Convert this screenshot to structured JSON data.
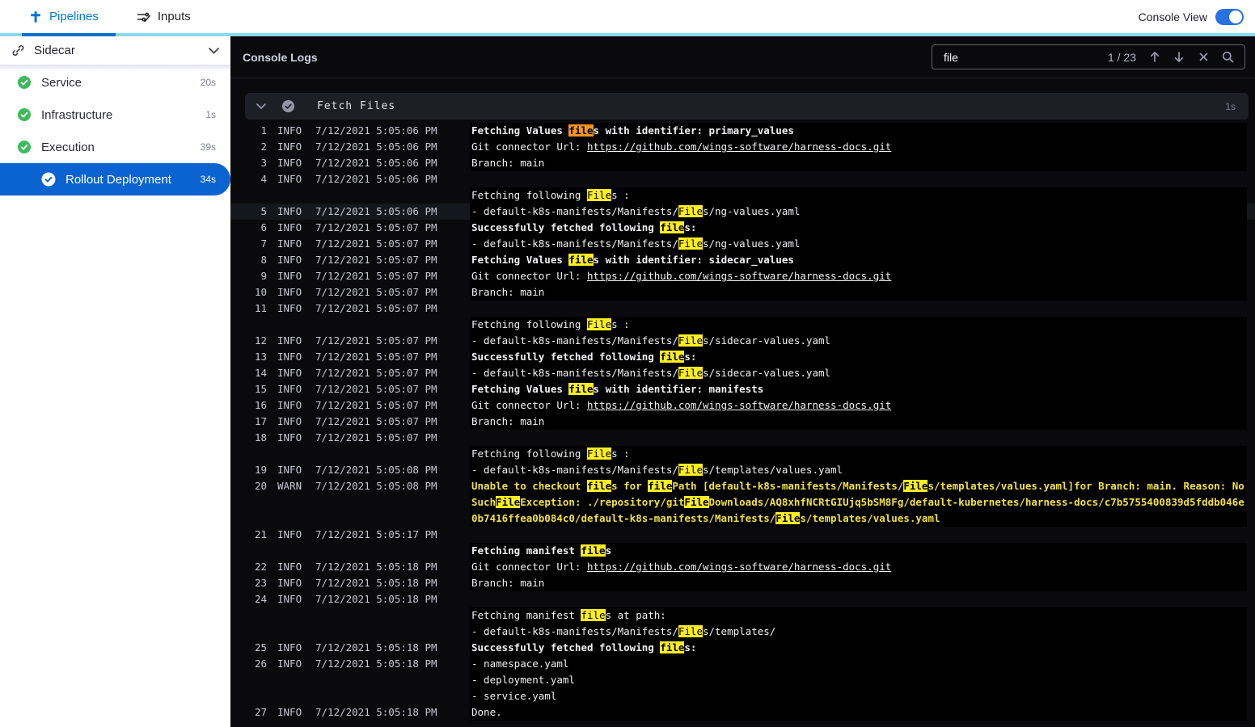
{
  "topbar": {
    "tabs": [
      {
        "label": "Pipelines",
        "active": true
      },
      {
        "label": "Inputs",
        "active": false
      }
    ],
    "console_view_label": "Console View",
    "console_view_on": true
  },
  "sidebar": {
    "pipeline_name": "Sidecar",
    "items": [
      {
        "label": "Service",
        "duration": "20s",
        "status": "success",
        "selected": false
      },
      {
        "label": "Infrastructure",
        "duration": "1s",
        "status": "success",
        "selected": false
      },
      {
        "label": "Execution",
        "duration": "39s",
        "status": "success",
        "selected": false
      },
      {
        "label": "Rollout Deployment",
        "duration": "34s",
        "status": "success",
        "selected": true
      }
    ]
  },
  "console": {
    "title": "Console Logs",
    "search": {
      "value": "file",
      "count": "1 / 23"
    },
    "section": {
      "title": "Fetch Files",
      "duration": "1s"
    },
    "lines": [
      {
        "num": "1",
        "level": "INFO",
        "time": "7/12/2021 5:05:06 PM",
        "text": "Fetching Values files with identifier: primary_values",
        "bold": true
      },
      {
        "num": "2",
        "level": "INFO",
        "time": "7/12/2021 5:05:06 PM",
        "text": "Git connector Url: https://github.com/wings-software/harness-docs.git",
        "link": "https://github.com/wings-software/harness-docs.git"
      },
      {
        "num": "3",
        "level": "INFO",
        "time": "7/12/2021 5:05:06 PM",
        "text": "Branch: main"
      },
      {
        "num": "4",
        "level": "INFO",
        "time": "7/12/2021 5:05:06 PM",
        "text": ""
      },
      {
        "text": "Fetching following Files :"
      },
      {
        "num": "5",
        "level": "INFO",
        "time": "7/12/2021 5:05:06 PM",
        "text": "- default-k8s-manifests/Manifests/Files/ng-values.yaml",
        "highlight_row": true
      },
      {
        "num": "6",
        "level": "INFO",
        "time": "7/12/2021 5:05:07 PM",
        "text": "Successfully fetched following files:",
        "bold": true
      },
      {
        "num": "7",
        "level": "INFO",
        "time": "7/12/2021 5:05:07 PM",
        "text": "- default-k8s-manifests/Manifests/Files/ng-values.yaml"
      },
      {
        "num": "8",
        "level": "INFO",
        "time": "7/12/2021 5:05:07 PM",
        "text": "Fetching Values files with identifier: sidecar_values",
        "bold": true
      },
      {
        "num": "9",
        "level": "INFO",
        "time": "7/12/2021 5:05:07 PM",
        "text": "Git connector Url: https://github.com/wings-software/harness-docs.git",
        "link": "https://github.com/wings-software/harness-docs.git"
      },
      {
        "num": "10",
        "level": "INFO",
        "time": "7/12/2021 5:05:07 PM",
        "text": "Branch: main"
      },
      {
        "num": "11",
        "level": "INFO",
        "time": "7/12/2021 5:05:07 PM",
        "text": ""
      },
      {
        "text": "Fetching following Files :"
      },
      {
        "num": "12",
        "level": "INFO",
        "time": "7/12/2021 5:05:07 PM",
        "text": "- default-k8s-manifests/Manifests/Files/sidecar-values.yaml"
      },
      {
        "num": "13",
        "level": "INFO",
        "time": "7/12/2021 5:05:07 PM",
        "text": "Successfully fetched following files:",
        "bold": true
      },
      {
        "num": "14",
        "level": "INFO",
        "time": "7/12/2021 5:05:07 PM",
        "text": "- default-k8s-manifests/Manifests/Files/sidecar-values.yaml"
      },
      {
        "num": "15",
        "level": "INFO",
        "time": "7/12/2021 5:05:07 PM",
        "text": "Fetching Values files with identifier: manifests",
        "bold": true
      },
      {
        "num": "16",
        "level": "INFO",
        "time": "7/12/2021 5:05:07 PM",
        "text": "Git connector Url: https://github.com/wings-software/harness-docs.git",
        "link": "https://github.com/wings-software/harness-docs.git"
      },
      {
        "num": "17",
        "level": "INFO",
        "time": "7/12/2021 5:05:07 PM",
        "text": "Branch: main"
      },
      {
        "num": "18",
        "level": "INFO",
        "time": "7/12/2021 5:05:07 PM",
        "text": ""
      },
      {
        "text": "Fetching following Files :"
      },
      {
        "num": "19",
        "level": "INFO",
        "time": "7/12/2021 5:05:08 PM",
        "text": "- default-k8s-manifests/Manifests/Files/templates/values.yaml"
      },
      {
        "num": "20",
        "level": "WARN",
        "time": "7/12/2021 5:05:08 PM",
        "text": "Unable to checkout files for filePath [default-k8s-manifests/Manifests/Files/templates/values.yaml]for Branch: main. Reason: NoSuchFileException: ./repository/gitFileDownloads/AQ8xhfNCRtGIUjq5bSM8Fg/default-kubernetes/harness-docs/c7b5755400839d5fddb046e0b7416ffea0b084c0/default-k8s-manifests/Manifests/Files/templates/values.yaml",
        "warn": true
      },
      {
        "num": "21",
        "level": "INFO",
        "time": "7/12/2021 5:05:17 PM",
        "text": ""
      },
      {
        "text": "Fetching manifest files",
        "bold": true
      },
      {
        "num": "22",
        "level": "INFO",
        "time": "7/12/2021 5:05:18 PM",
        "text": "Git connector Url: https://github.com/wings-software/harness-docs.git",
        "link": "https://github.com/wings-software/harness-docs.git"
      },
      {
        "num": "23",
        "level": "INFO",
        "time": "7/12/2021 5:05:18 PM",
        "text": "Branch: main"
      },
      {
        "num": "24",
        "level": "INFO",
        "time": "7/12/2021 5:05:18 PM",
        "text": ""
      },
      {
        "text": "Fetching manifest files at path:"
      },
      {
        "text": "- default-k8s-manifests/Manifests/Files/templates/"
      },
      {
        "num": "25",
        "level": "INFO",
        "time": "7/12/2021 5:05:18 PM",
        "text": "Successfully fetched following files:",
        "bold": true
      },
      {
        "num": "26",
        "level": "INFO",
        "time": "7/12/2021 5:05:18 PM",
        "text": "- namespace.yaml"
      },
      {
        "text": "- deployment.yaml"
      },
      {
        "text": "- service.yaml"
      },
      {
        "num": "27",
        "level": "INFO",
        "time": "7/12/2021 5:05:18 PM",
        "text": "Done."
      }
    ]
  },
  "icons": {
    "topbar": [
      "pipeline-icon",
      "inputs-icon"
    ],
    "sidebar": [
      "link-icon",
      "chevron-down-icon",
      "check-circle-icon"
    ],
    "search": [
      "arrow-up-icon",
      "arrow-down-icon",
      "close-icon",
      "search-icon"
    ],
    "section": [
      "chevron-down-icon",
      "check-circle-icon"
    ]
  },
  "colors": {
    "accent_blue": "#0278d5",
    "selected_blue": "#0b63d1",
    "accent_cyan": "#8ed7f3",
    "success_green": "#3eba5c",
    "match_highlight": "#fdee21",
    "current_match_highlight": "#f7941e",
    "warn_yellow": "#f2e13c",
    "console_bg": "#0a0a0d"
  }
}
